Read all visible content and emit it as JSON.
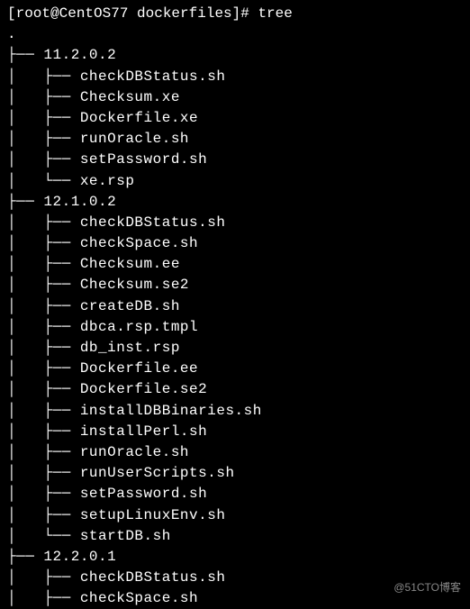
{
  "prompt": "[root@CentOS77 dockerfiles]# tree",
  "dot": ".",
  "tree": [
    {
      "prefix": "├── ",
      "name": "11.2.0.2"
    },
    {
      "prefix": "│   ├── ",
      "name": "checkDBStatus.sh"
    },
    {
      "prefix": "│   ├── ",
      "name": "Checksum.xe"
    },
    {
      "prefix": "│   ├── ",
      "name": "Dockerfile.xe"
    },
    {
      "prefix": "│   ├── ",
      "name": "runOracle.sh"
    },
    {
      "prefix": "│   ├── ",
      "name": "setPassword.sh"
    },
    {
      "prefix": "│   └── ",
      "name": "xe.rsp"
    },
    {
      "prefix": "├── ",
      "name": "12.1.0.2"
    },
    {
      "prefix": "│   ├── ",
      "name": "checkDBStatus.sh"
    },
    {
      "prefix": "│   ├── ",
      "name": "checkSpace.sh"
    },
    {
      "prefix": "│   ├── ",
      "name": "Checksum.ee"
    },
    {
      "prefix": "│   ├── ",
      "name": "Checksum.se2"
    },
    {
      "prefix": "│   ├── ",
      "name": "createDB.sh"
    },
    {
      "prefix": "│   ├── ",
      "name": "dbca.rsp.tmpl"
    },
    {
      "prefix": "│   ├── ",
      "name": "db_inst.rsp"
    },
    {
      "prefix": "│   ├── ",
      "name": "Dockerfile.ee"
    },
    {
      "prefix": "│   ├── ",
      "name": "Dockerfile.se2"
    },
    {
      "prefix": "│   ├── ",
      "name": "installDBBinaries.sh"
    },
    {
      "prefix": "│   ├── ",
      "name": "installPerl.sh"
    },
    {
      "prefix": "│   ├── ",
      "name": "runOracle.sh"
    },
    {
      "prefix": "│   ├── ",
      "name": "runUserScripts.sh"
    },
    {
      "prefix": "│   ├── ",
      "name": "setPassword.sh"
    },
    {
      "prefix": "│   ├── ",
      "name": "setupLinuxEnv.sh"
    },
    {
      "prefix": "│   └── ",
      "name": "startDB.sh"
    },
    {
      "prefix": "├── ",
      "name": "12.2.0.1"
    },
    {
      "prefix": "│   ├── ",
      "name": "checkDBStatus.sh"
    },
    {
      "prefix": "│   ├── ",
      "name": "checkSpace.sh"
    }
  ],
  "watermark": "@51CTO博客"
}
